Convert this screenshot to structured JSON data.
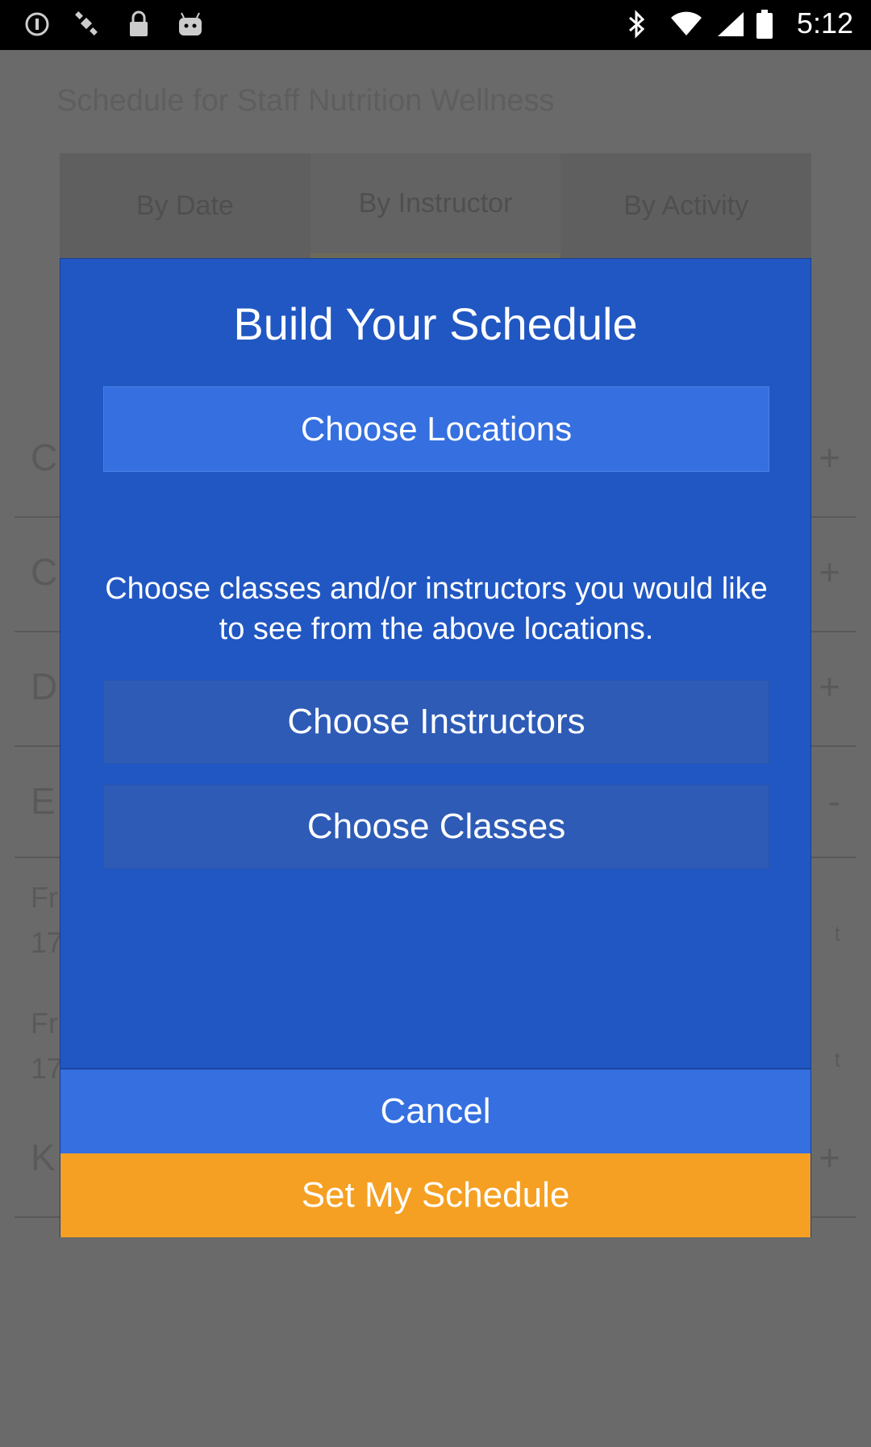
{
  "status_bar": {
    "time": "5:12",
    "icons": [
      "info-icon",
      "satellite-icon",
      "lock-icon",
      "android-icon",
      "bluetooth-icon",
      "wifi-icon",
      "signal-icon",
      "battery-icon"
    ]
  },
  "background": {
    "header_text": "Schedule for Staff Nutrition Wellness",
    "tabs": [
      {
        "label": "By Date"
      },
      {
        "label": "By Instructor"
      },
      {
        "label": "By Activity"
      }
    ],
    "rows": [
      {
        "letter": "C",
        "action": "+"
      },
      {
        "letter": "C",
        "action": "+"
      },
      {
        "letter": "D",
        "action": "+"
      },
      {
        "letter": "E",
        "action": "-"
      },
      {
        "letter": "Fr",
        "sub": "17",
        "action": "t"
      },
      {
        "letter": "Fr",
        "sub": "17",
        "action": "t"
      },
      {
        "letter": "K",
        "action": "+"
      }
    ]
  },
  "dialog": {
    "title": "Build Your Schedule",
    "choose_locations": "Choose Locations",
    "info": "Choose classes and/or instructors you would like to see from the above locations.",
    "choose_instructors": "Choose Instructors",
    "choose_classes": "Choose Classes",
    "cancel": "Cancel",
    "set_schedule": "Set My Schedule"
  },
  "colors": {
    "dialog_bg": "#2157c2",
    "primary_button": "#356fe0",
    "disabled_button": "#2d5bb6",
    "accent_orange": "#f5a022"
  }
}
